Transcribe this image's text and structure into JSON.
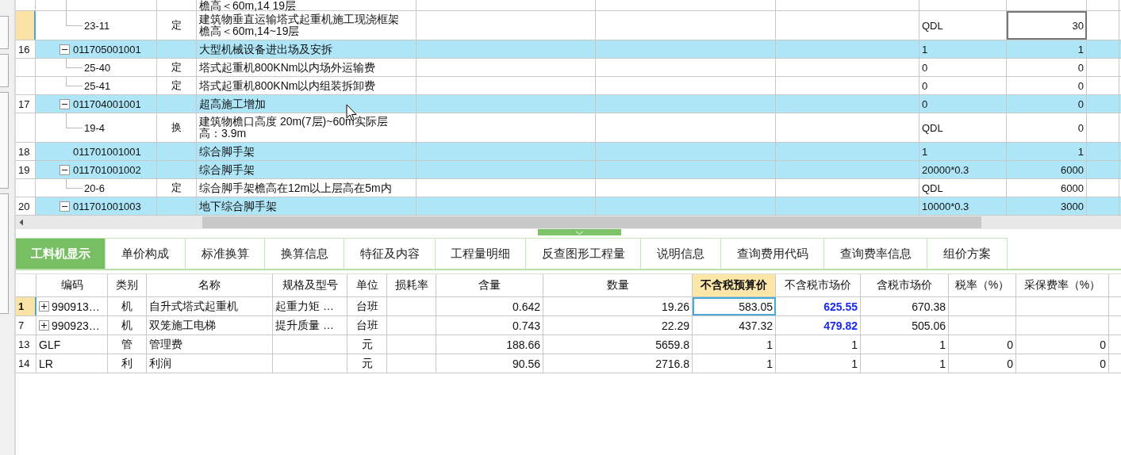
{
  "top_table": {
    "rows": [
      {
        "kind": "clipped",
        "selected": false,
        "num": "",
        "code": "",
        "type": "",
        "name": "檐高＜60m,14 19层",
        "expr": "",
        "qty": ""
      },
      {
        "kind": "sub",
        "selected": true,
        "num": "",
        "code": "23-11",
        "type": "定",
        "name": "建筑物垂直运输塔式起重机施工现浇框架檐高＜60m,14~19层",
        "expr": "QDL",
        "qty": "30"
      },
      {
        "kind": "group",
        "expanded": true,
        "selected": false,
        "num": "16",
        "code": "011705001001",
        "type": "",
        "name": "大型机械设备进出场及安拆",
        "expr": "1",
        "qty": "1"
      },
      {
        "kind": "sub",
        "selected": false,
        "num": "",
        "code": "25-40",
        "type": "定",
        "name": "塔式起重机800KNm以内场外运输费",
        "expr": "0",
        "qty": "0"
      },
      {
        "kind": "sub",
        "selected": false,
        "num": "",
        "code": "25-41",
        "type": "定",
        "name": "塔式起重机800KNm以内组装拆卸费",
        "expr": "0",
        "qty": "0"
      },
      {
        "kind": "group",
        "expanded": true,
        "selected": false,
        "num": "17",
        "code": "011704001001",
        "type": "",
        "name": "超高施工增加",
        "expr": "0",
        "qty": "0"
      },
      {
        "kind": "sub",
        "selected": false,
        "num": "",
        "code": "19-4",
        "type": "换",
        "name": "建筑物檐口高度 20m(7层)~60m实际层高：3.9m",
        "expr": "QDL",
        "qty": "0"
      },
      {
        "kind": "item",
        "selected": false,
        "num": "18",
        "code": "011701001001",
        "type": "",
        "name": "综合脚手架",
        "expr": "1",
        "qty": "1"
      },
      {
        "kind": "group",
        "expanded": true,
        "selected": false,
        "num": "19",
        "code": "011701001002",
        "type": "",
        "name": "综合脚手架",
        "expr": "20000*0.3",
        "qty": "6000"
      },
      {
        "kind": "sub",
        "selected": false,
        "num": "",
        "code": "20-6",
        "type": "定",
        "name": "综合脚手架檐高在12m以上层高在5m内",
        "expr": "QDL",
        "qty": "6000"
      },
      {
        "kind": "group",
        "expanded": true,
        "selected": false,
        "num": "20",
        "code": "011701001003",
        "type": "",
        "name": "地下综合脚手架",
        "expr": "10000*0.3",
        "qty": "3000"
      }
    ]
  },
  "tabs": [
    {
      "label": "工料机显示",
      "selected": true
    },
    {
      "label": "单价构成",
      "selected": false
    },
    {
      "label": "标准换算",
      "selected": false
    },
    {
      "label": "换算信息",
      "selected": false
    },
    {
      "label": "特征及内容",
      "selected": false
    },
    {
      "label": "工程量明细",
      "selected": false
    },
    {
      "label": "反查图形工程量",
      "selected": false
    },
    {
      "label": "说明信息",
      "selected": false
    },
    {
      "label": "查询费用代码",
      "selected": false
    },
    {
      "label": "查询费率信息",
      "selected": false
    },
    {
      "label": "组价方案",
      "selected": false
    }
  ],
  "detail_table": {
    "columns": [
      {
        "label": "编码",
        "selected": false
      },
      {
        "label": "类别",
        "selected": false
      },
      {
        "label": "名称",
        "selected": false
      },
      {
        "label": "规格及型号",
        "selected": false
      },
      {
        "label": "单位",
        "selected": false
      },
      {
        "label": "损耗率",
        "selected": false
      },
      {
        "label": "含量",
        "selected": false
      },
      {
        "label": "数量",
        "selected": false
      },
      {
        "label": "不含税预算价",
        "selected": true
      },
      {
        "label": "不含税市场价",
        "selected": false
      },
      {
        "label": "含税市场价",
        "selected": false
      },
      {
        "label": "税率（%）",
        "selected": false
      },
      {
        "label": "采保费率（%）",
        "selected": false
      }
    ],
    "rows": [
      {
        "kind": "group",
        "expanded": false,
        "selected": true,
        "changed": true,
        "num": "1",
        "cells": [
          "990913…",
          "机",
          "自升式塔式起重机",
          "起重力矩 …",
          "台班",
          "",
          "0.642",
          "19.26",
          "583.05",
          "625.55",
          "670.38",
          "",
          ""
        ]
      },
      {
        "kind": "group",
        "expanded": false,
        "selected": false,
        "changed": true,
        "num": "7",
        "cells": [
          "990923…",
          "机",
          "双笼施工电梯",
          "提升质量 …",
          "台班",
          "",
          "0.743",
          "22.29",
          "437.32",
          "479.82",
          "505.06",
          "",
          ""
        ]
      },
      {
        "kind": "item",
        "selected": false,
        "changed": false,
        "num": "13",
        "cells": [
          "GLF",
          "管",
          "管理费",
          "",
          "元",
          "",
          "188.66",
          "5659.8",
          "1",
          "1",
          "1",
          "0",
          "0"
        ]
      },
      {
        "kind": "item",
        "selected": false,
        "changed": false,
        "num": "14",
        "cells": [
          "LR",
          "利",
          "利润",
          "",
          "元",
          "",
          "90.56",
          "2716.8",
          "1",
          "1",
          "1",
          "0",
          "0"
        ]
      }
    ]
  }
}
